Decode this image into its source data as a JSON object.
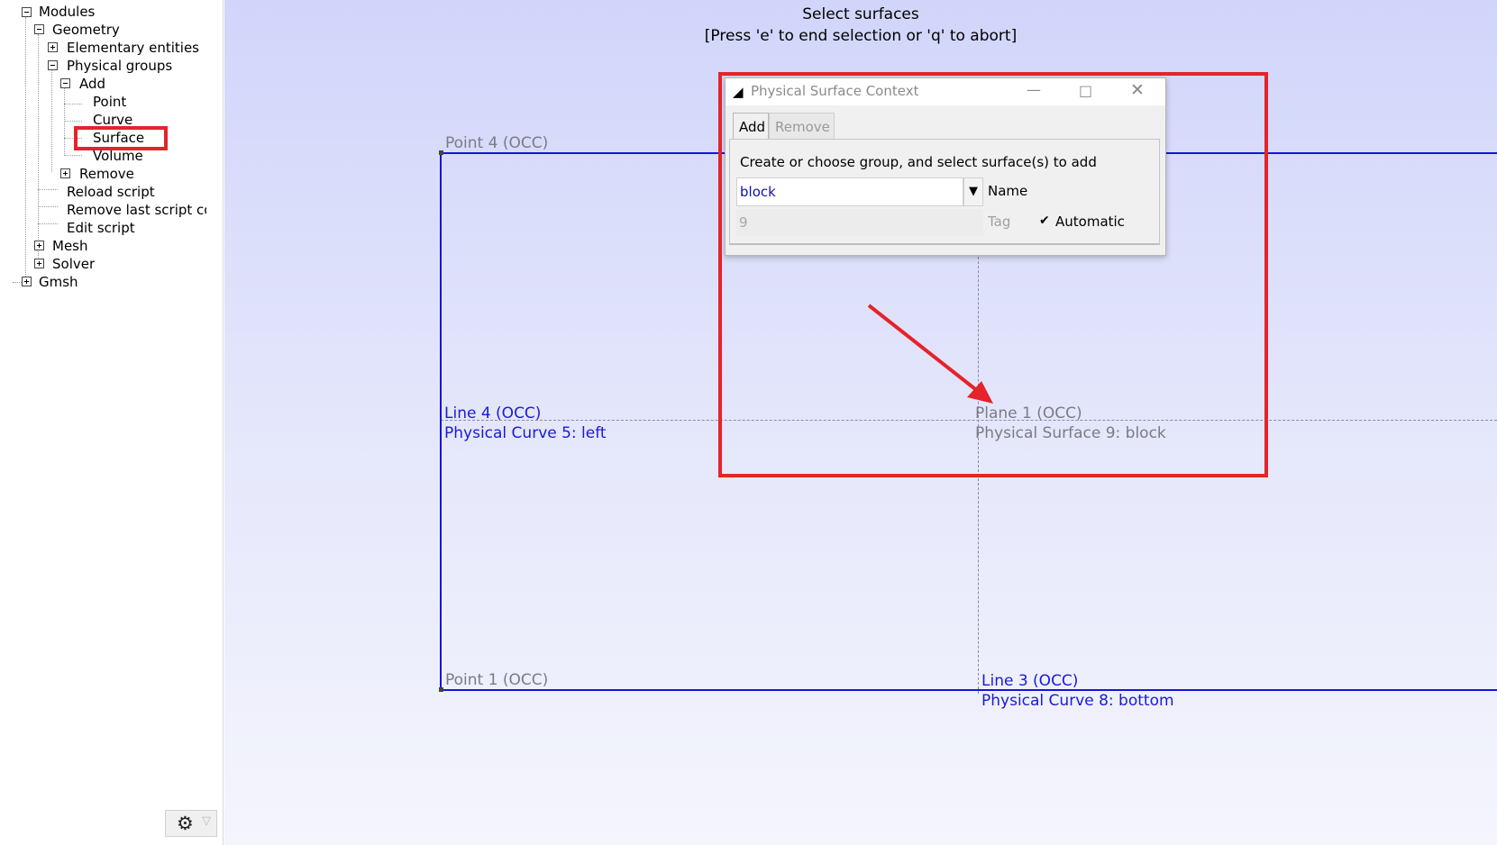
{
  "tree": {
    "items": [
      {
        "label": "Modules",
        "toggle": "minus"
      },
      {
        "label": "Geometry",
        "toggle": "minus"
      },
      {
        "label": "Elementary entities",
        "toggle": "plus"
      },
      {
        "label": "Physical groups",
        "toggle": "minus"
      },
      {
        "label": "Add",
        "toggle": "minus"
      },
      {
        "label": "Point"
      },
      {
        "label": "Curve"
      },
      {
        "label": "Surface",
        "highlighted": true
      },
      {
        "label": "Volume"
      },
      {
        "label": "Remove",
        "toggle": "plus"
      },
      {
        "label": "Reload script"
      },
      {
        "label": "Remove last script command",
        "display": "Remove last script cor"
      },
      {
        "label": "Edit script"
      },
      {
        "label": "Mesh",
        "toggle": "plus"
      },
      {
        "label": "Solver",
        "toggle": "plus"
      },
      {
        "label": "Gmsh",
        "toggle": "plus"
      }
    ]
  },
  "status": {
    "line1": "Select surfaces",
    "line2": "[Press 'e' to end selection or 'q' to abort]"
  },
  "graphics": {
    "point4": "Point 4 (OCC)",
    "point1": "Point 1 (OCC)",
    "line4": "Line 4 (OCC)",
    "phys_curve5": "Physical Curve 5: left",
    "plane1": "Plane 1 (OCC)",
    "phys_surface9": "Physical Surface 9: block",
    "line3": "Line 3 (OCC)",
    "phys_curve8": "Physical Curve 8: bottom"
  },
  "dialog": {
    "title": "Physical Surface Context",
    "tabs": [
      "Add",
      "Remove"
    ],
    "active_tab": "Add",
    "instruction": "Create or choose group, and select surface(s) to add",
    "name_value": "block",
    "name_label": "Name",
    "tag_value": "9",
    "tag_label": "Tag",
    "automatic_label": "Automatic",
    "automatic_checked": true
  },
  "colors": {
    "geometry_line": "#1515d8",
    "annotation": "#e5232a"
  }
}
